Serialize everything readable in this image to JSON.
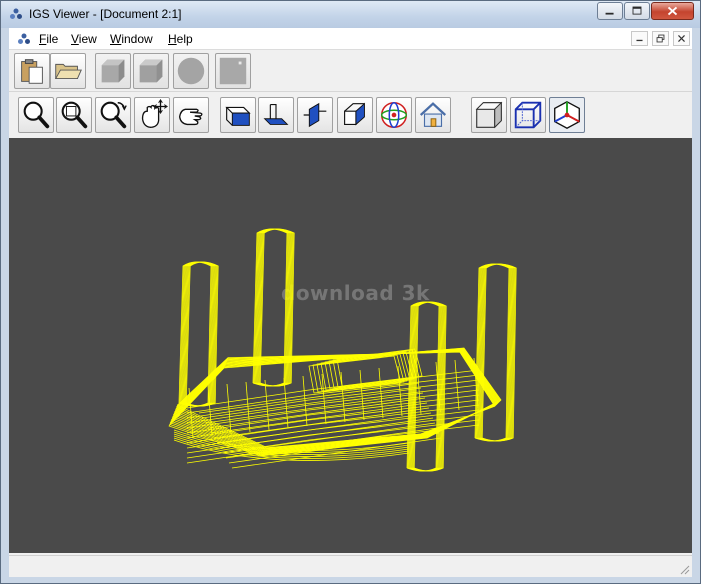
{
  "window": {
    "title": "IGS Viewer - [Document 2:1]"
  },
  "menu": {
    "items": [
      {
        "label": "File",
        "key": "F",
        "rest": "ile"
      },
      {
        "label": "View",
        "key": "V",
        "rest": "iew"
      },
      {
        "label": "Window",
        "key": "W",
        "rest": "indow"
      },
      {
        "label": "Help",
        "key": "H",
        "rest": "elp"
      }
    ]
  },
  "toolbar1": {
    "buttons": [
      "paste-icon",
      "open-folder-icon",
      "solid-box-icon",
      "shaded-box-icon",
      "sphere-icon",
      "flat-square-icon"
    ]
  },
  "toolbar2": {
    "buttons": [
      "zoom-icon",
      "zoom-window-icon",
      "rotate-icon",
      "pan-icon",
      "hand-icon",
      "view-front-icon",
      "view-top-icon",
      "view-side-icon",
      "view-iso-icon",
      "axes-sphere-icon",
      "home-icon",
      "shaded-mode-icon",
      "wireframe-mode-icon",
      "axis-triad-icon"
    ]
  },
  "viewport": {
    "background": "#4a4a4a",
    "model_color": "#ffff00",
    "watermark": "download 3k"
  },
  "colors": {
    "wire": "#ffff00",
    "triad_red": "#e02020",
    "triad_green": "#20a020",
    "triad_blue": "#2040d0"
  }
}
